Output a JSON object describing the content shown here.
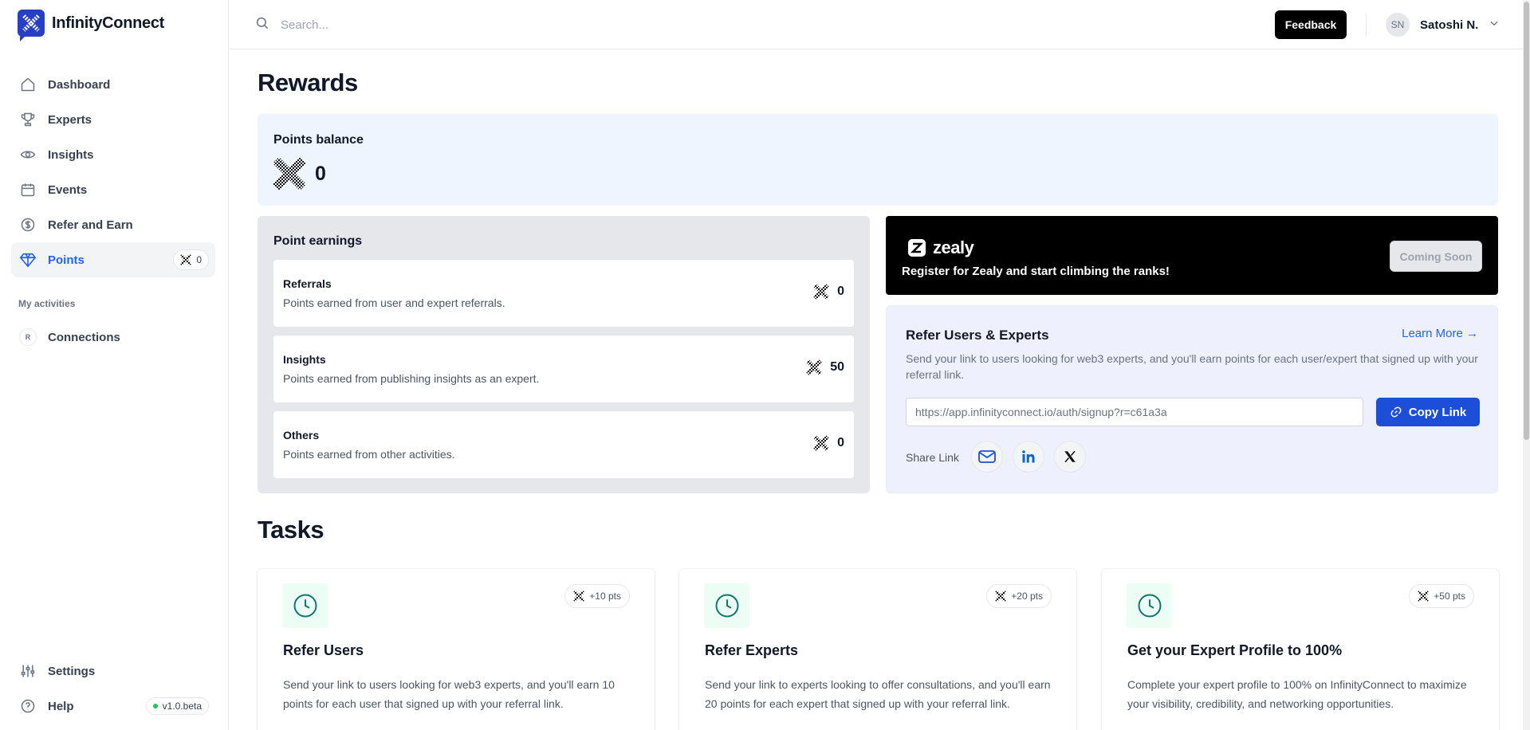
{
  "app": {
    "name": "InfinityConnect"
  },
  "sidebar": {
    "items": [
      {
        "label": "Dashboard",
        "icon": "home-icon"
      },
      {
        "label": "Experts",
        "icon": "trophy-icon"
      },
      {
        "label": "Insights",
        "icon": "eye-icon"
      },
      {
        "label": "Events",
        "icon": "calendar-icon"
      },
      {
        "label": "Refer and Earn",
        "icon": "dollar-icon"
      },
      {
        "label": "Points",
        "icon": "diamond-icon",
        "badge": "0",
        "active": true
      }
    ],
    "section_label": "My activities",
    "activities": [
      {
        "label": "Connections",
        "icon_letter": "R"
      }
    ],
    "bottom": [
      {
        "label": "Settings",
        "icon": "sliders-icon"
      },
      {
        "label": "Help",
        "icon": "help-icon",
        "badge": "v1.0.beta"
      }
    ]
  },
  "header": {
    "search_placeholder": "Search...",
    "feedback_label": "Feedback",
    "user_initials": "SN",
    "user_name": "Satoshi N."
  },
  "page": {
    "title": "Rewards"
  },
  "balance": {
    "label": "Points balance",
    "value": "0"
  },
  "earnings": {
    "title": "Point earnings",
    "items": [
      {
        "title": "Referrals",
        "desc": "Points earned from user and expert referrals.",
        "value": "0"
      },
      {
        "title": "Insights",
        "desc": "Points earned from publishing insights as an expert.",
        "value": "50"
      },
      {
        "title": "Others",
        "desc": "Points earned from other activities.",
        "value": "0"
      }
    ]
  },
  "zealy": {
    "brand": "zealy",
    "text": "Register for Zealy and start climbing the ranks!",
    "button": "Coming Soon"
  },
  "refer": {
    "title": "Refer Users & Experts",
    "learn_more": "Learn More →",
    "desc": "Send your link to users looking for web3 experts, and you'll earn points for each user/expert that signed up with your referral link.",
    "link": "https://app.infinityconnect.io/auth/signup?r=c61a3a",
    "copy_label": "Copy Link",
    "share_label": "Share Link"
  },
  "tasks": {
    "title": "Tasks",
    "items": [
      {
        "points": "+10 pts",
        "title": "Refer Users",
        "desc": "Send your link to users looking for web3 experts, and you'll earn 10 points for each user that signed up with your referral link."
      },
      {
        "points": "+20 pts",
        "title": "Refer Experts",
        "desc": "Send your link to experts looking to offer consultations, and you'll earn 20 points for each expert that signed up with your referral link."
      },
      {
        "points": "+50 pts",
        "title": "Get your Expert Profile to 100%",
        "desc": "Complete your expert profile to 100% on InfinityConnect to maximize your visibility, credibility, and networking opportunities."
      }
    ]
  },
  "colors": {
    "accent": "#2563eb",
    "brand": "#2540c7",
    "balance_bg": "#eff5fe",
    "refer_bg": "#eef1fd"
  }
}
